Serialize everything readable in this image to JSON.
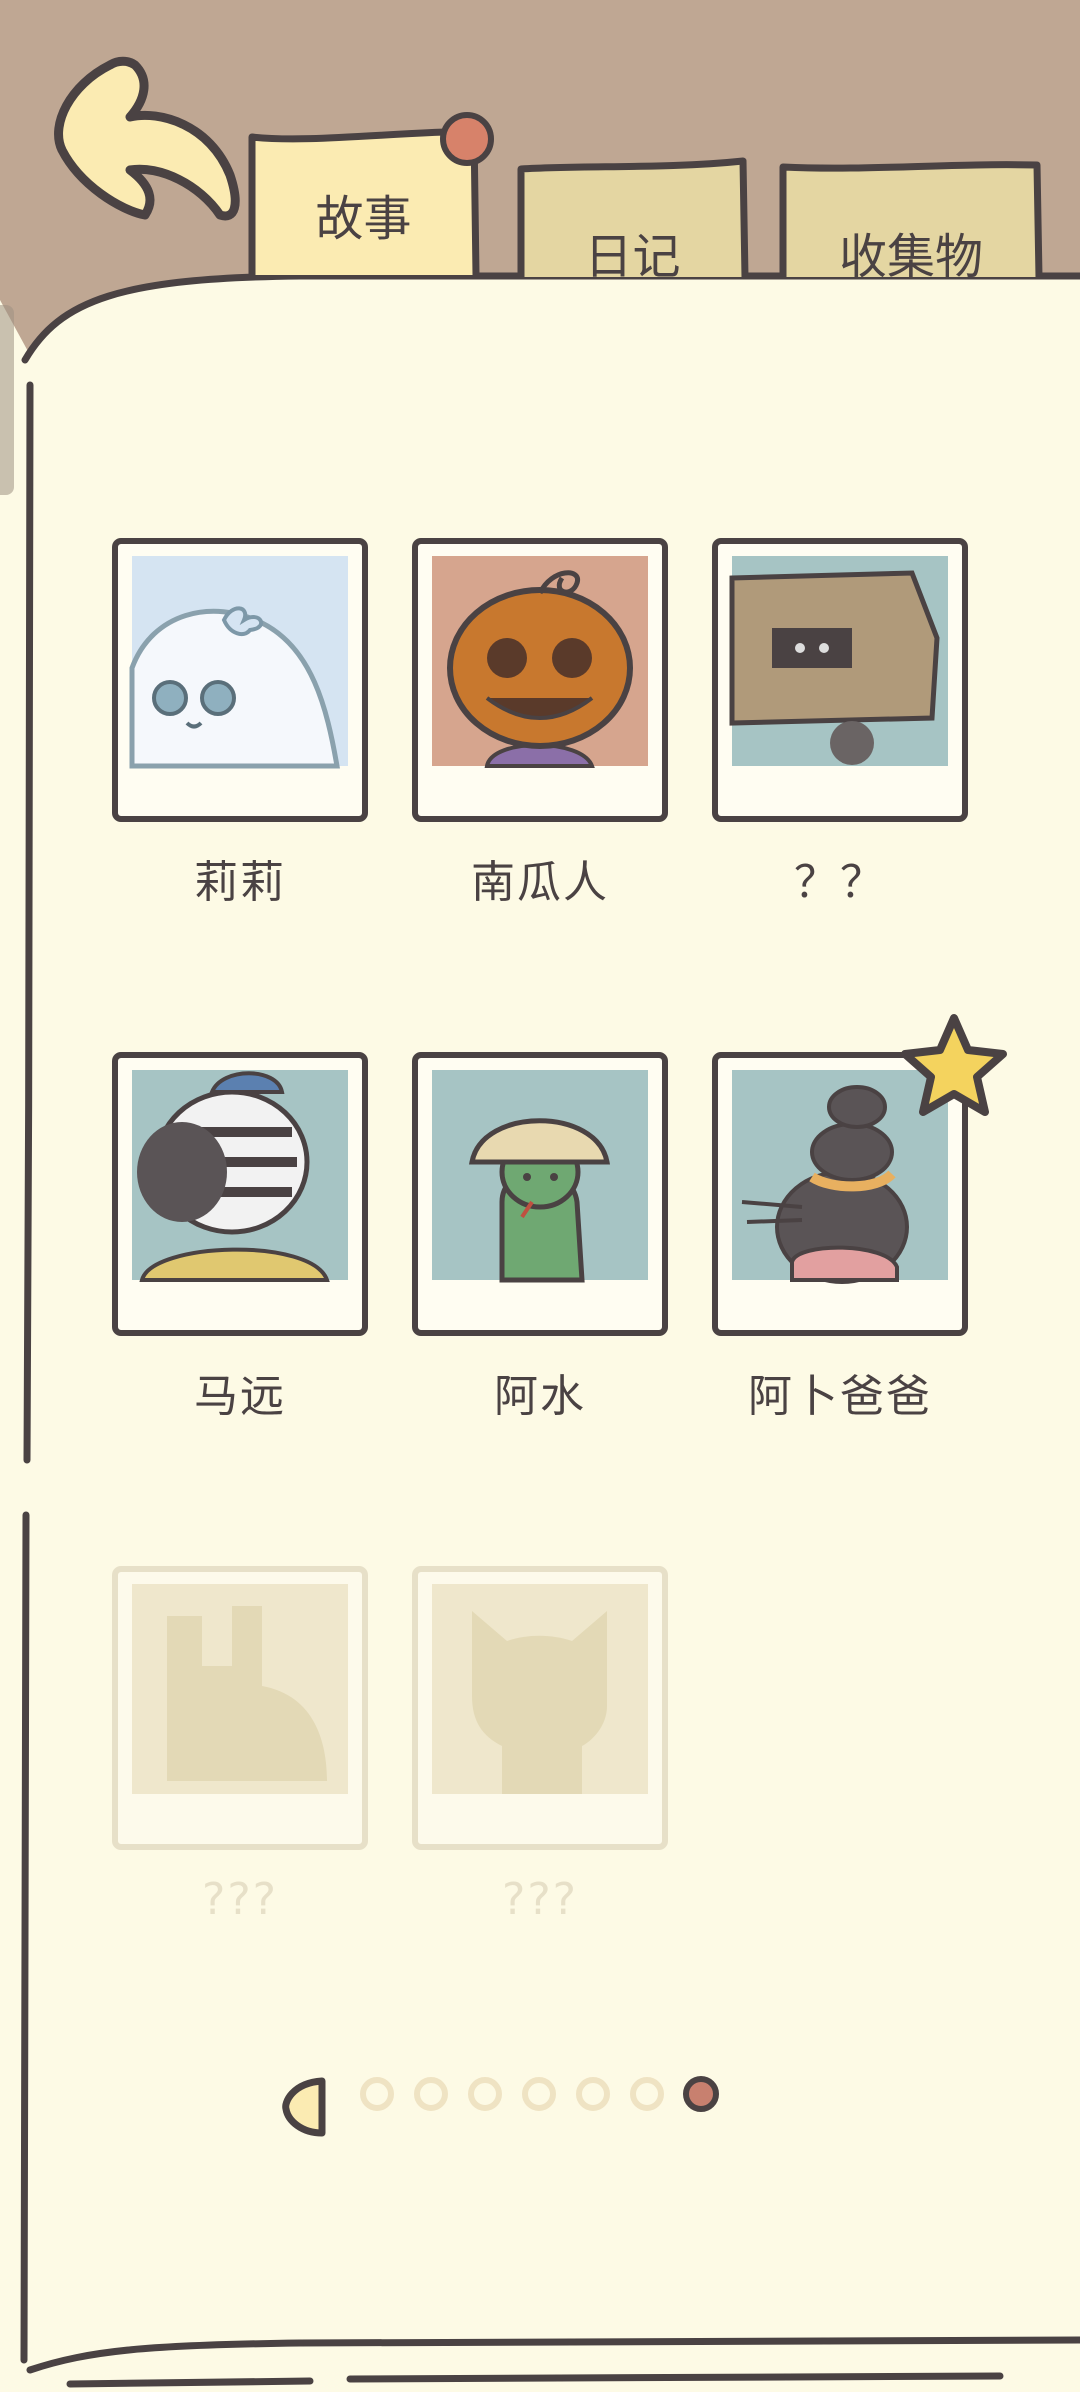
{
  "tabs": [
    {
      "label": "故事",
      "active": true
    },
    {
      "label": "日记",
      "active": false
    },
    {
      "label": "收集物",
      "active": false
    }
  ],
  "characters": [
    {
      "name": "莉莉",
      "portrait": "ghost-girl-with-bow",
      "locked": false
    },
    {
      "name": "南瓜人",
      "portrait": "pumpkin-head",
      "locked": false
    },
    {
      "name": "？？",
      "portrait": "cardboard-box-head",
      "locked": false
    },
    {
      "name": "马远",
      "portrait": "zebra-with-cap",
      "locked": false
    },
    {
      "name": "阿水",
      "portrait": "green-snake-in-bucket-hat",
      "locked": false,
      "card_color": "#A6C4C4"
    },
    {
      "name": "阿卜爸爸",
      "portrait": "stacked-moles",
      "locked": false,
      "starred": true
    },
    {
      "name": "???",
      "portrait": "rabbit-silhouette",
      "locked": true
    },
    {
      "name": "???",
      "portrait": "cat-silhouette",
      "locked": true
    }
  ],
  "pager": {
    "total_pages": 7,
    "current_page": 7
  },
  "colors": {
    "header_bg": "#BFA793",
    "page_bg": "#FDFAE5",
    "tab_active": "#FBEBB2",
    "tab_inactive": "#E4D6A2",
    "outline": "#4a4243",
    "pin": "#D7826A",
    "star": "#F4D35E",
    "locked": "#E7E0C8",
    "pager_active": "#C8806F"
  }
}
